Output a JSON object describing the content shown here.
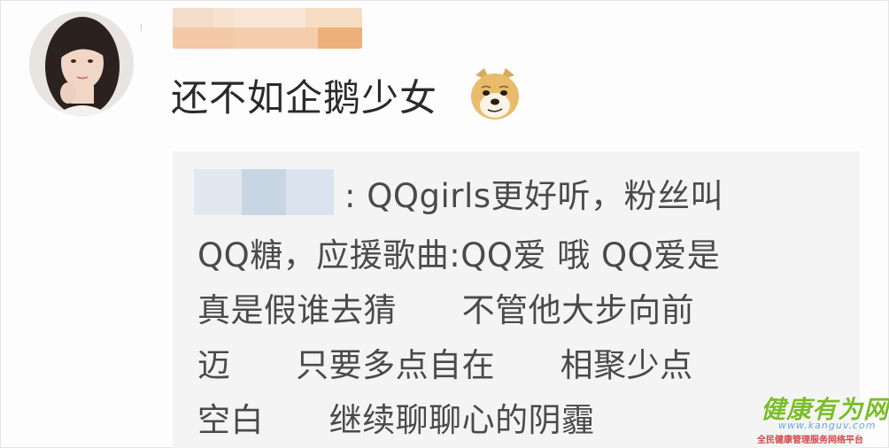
{
  "comment": {
    "text": "还不如企鹅少女",
    "emoji": "doge-emoji"
  },
  "reply": {
    "line1": ": QQgirls更好听，粉丝叫",
    "line2": "QQ糖，应援歌曲:QQ爱 哦 QQ爱是",
    "line3": "真是假谁去猜      不管他大步向前",
    "line4": "迈      只要多点自在      相聚少点",
    "line5": "空白      继续聊聊心的阴霾"
  },
  "watermark": {
    "main": "健康有为网",
    "url": "www.kanguv.com",
    "sub": "全民健康管理服务网络平台"
  },
  "colors": {
    "name_blur": [
      "#f7dcc6",
      "#f2c9a5",
      "#f6d6b8",
      "#efb57f"
    ],
    "reply_name_blur": [
      "#dfe7ef",
      "#c9d7e5",
      "#d8e2ec"
    ],
    "reply_bg": "#f4f4f4",
    "watermark_green": "#7cbd2b"
  }
}
